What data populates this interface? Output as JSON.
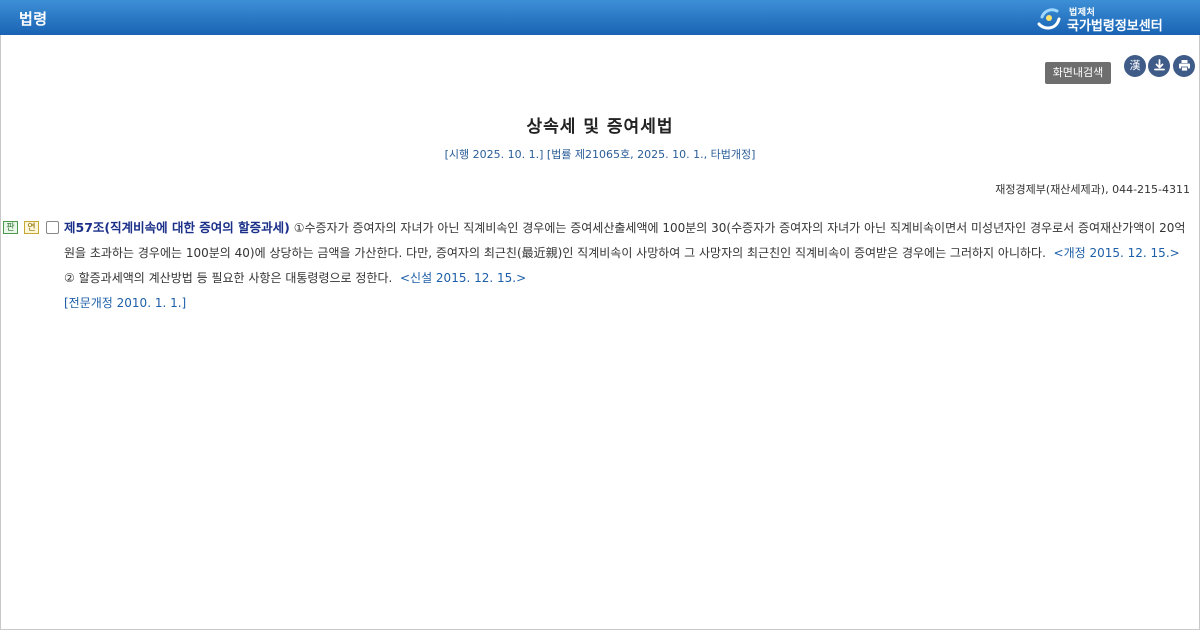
{
  "header": {
    "title": "법령",
    "logo_small": "법제처",
    "logo_main": "국가법령정보센터"
  },
  "toolbar": {
    "search_label": "화면내검색",
    "hanja_label": "漢",
    "icons": [
      "download-icon",
      "print-icon"
    ]
  },
  "law": {
    "title": "상속세 및 증여세법",
    "enforcement": "[시행 2025. 10. 1.] [법률 제21065호, 2025. 10. 1., 타법개정]",
    "ministry": "재정경제부(재산세제과), 044-215-4311"
  },
  "article": {
    "badge_pan": "판",
    "badge_yeon": "연",
    "heading": "제57조(직계비속에 대한 증여의 할증과세)",
    "p1_text": " ①수증자가 증여자의 자녀가 아닌 직계비속인 경우에는 증여세산출세액에 100분의 30(수증자가 증여자의 자녀가 아닌 직계비속이면서 미성년자인 경우로서 증여재산가액이 20억원을 초과하는 경우에는 100분의 40)에 상당하는 금액을 가산한다. 다만, 증여자의 최근친(最近親)인 직계비속이 사망하여 그 사망자의 최근친인 직계비속이 증여받은 경우에는 그러하지 아니하다.",
    "p1_amend": "<개정 2015. 12. 15.>",
    "p2_text": "② 할증과세액의 계산방법 등 필요한 사항은 대통령령으로 정한다.",
    "p2_amend": "<신설 2015. 12. 15.>",
    "full_amend": "[전문개정 2010. 1. 1.]"
  },
  "colors": {
    "header_top": "#3d8fd6",
    "header_bottom": "#1a63b4",
    "heading": "#1a2f88",
    "amend": "#1d5fa8",
    "button_round": "#3f5b87"
  }
}
